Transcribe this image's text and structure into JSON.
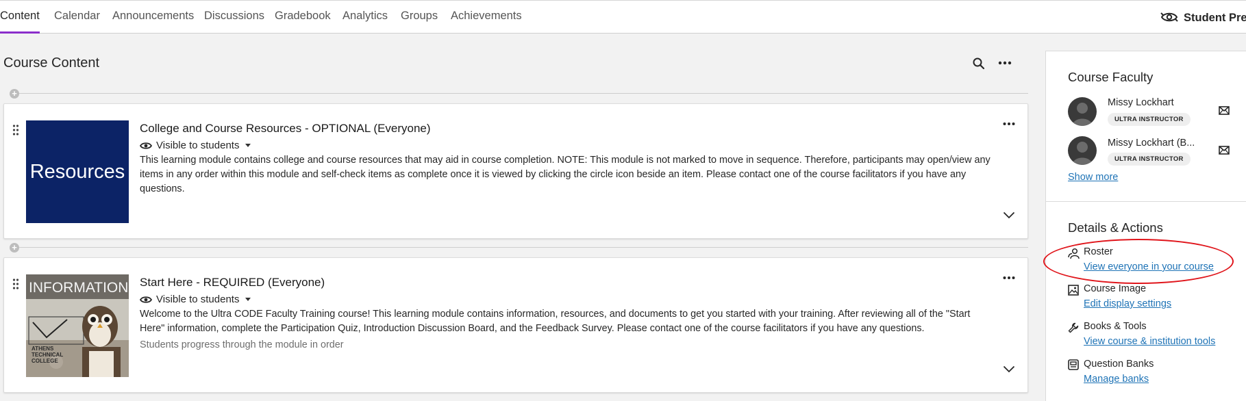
{
  "nav": {
    "tabs": [
      {
        "label": "Content",
        "active": true
      },
      {
        "label": "Calendar"
      },
      {
        "label": "Announcements"
      },
      {
        "label": "Discussions"
      },
      {
        "label": "Gradebook"
      },
      {
        "label": "Analytics"
      },
      {
        "label": "Groups"
      },
      {
        "label": "Achievements"
      }
    ],
    "student_preview": "Student Previ"
  },
  "main": {
    "title": "Course Content",
    "modules": [
      {
        "thumb_text": "Resources",
        "title": "College and Course Resources - OPTIONAL (Everyone)",
        "visibility": "Visible to students",
        "description": "This learning module contains college and course resources that may aid in course completion. NOTE: This module is not marked to move in sequence. Therefore, participants may open/view any items in any order within this module and self-check items as complete once it is viewed by clicking the circle icon beside an item. Please contact one of the course facilitators if you have any questions.",
        "subtext": ""
      },
      {
        "thumb_text": "INFORMATION",
        "thumb_sign": "ATHENS TECHNICAL COLLEGE",
        "title": "Start Here - REQUIRED (Everyone)",
        "visibility": "Visible to students",
        "description": "Welcome to the Ultra CODE Faculty Training course! This learning module contains information, resources, and documents to get you started with your training. After reviewing all of the \"Start Here\" information, complete the Participation Quiz, Introduction Discussion Board, and the Feedback Survey. Please contact one of the course facilitators if you have any questions.",
        "subtext": "Students progress through the module in order"
      }
    ]
  },
  "panel": {
    "faculty_heading": "Course Faculty",
    "faculty": [
      {
        "name": "Missy Lockhart",
        "role": "ULTRA INSTRUCTOR"
      },
      {
        "name": "Missy Lockhart (B...",
        "role": "ULTRA INSTRUCTOR"
      }
    ],
    "show_more": "Show more",
    "details_heading": "Details & Actions",
    "actions": [
      {
        "icon": "roster-icon",
        "label": "Roster",
        "link": "View everyone in your course"
      },
      {
        "icon": "course-image-icon",
        "label": "Course Image",
        "link": "Edit display settings"
      },
      {
        "icon": "wrench-icon",
        "label": "Books & Tools",
        "link": "View course & institution tools"
      },
      {
        "icon": "question-bank-icon",
        "label": "Question Banks",
        "link": "Manage banks"
      }
    ]
  },
  "colors": {
    "accent": "#8b2ecb",
    "link": "#1e73b6",
    "resources_thumb": "#0c2366",
    "annotation": "#e0151b"
  }
}
